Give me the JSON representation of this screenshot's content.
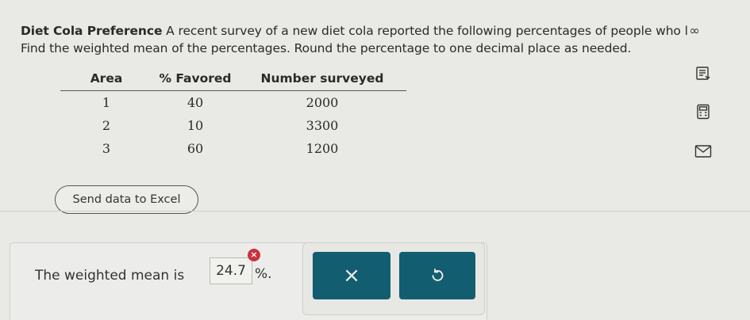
{
  "problem": {
    "title": "Diet Cola Preference",
    "text": " A recent survey of a new diet cola reported the following percentages of people who l",
    "instruction": "Find the weighted mean of the percentages. Round the percentage to one decimal place as needed.",
    "more_icon": "∞"
  },
  "table": {
    "headers": [
      "Area",
      "% Favored",
      "Number surveyed"
    ],
    "rows": [
      [
        "1",
        "40",
        "2000"
      ],
      [
        "2",
        "10",
        "3300"
      ],
      [
        "3",
        "60",
        "1200"
      ]
    ]
  },
  "side_icons": [
    "list-icon",
    "calculator-icon",
    "message-icon"
  ],
  "excel_button": "Send data to Excel",
  "answer": {
    "prefix": "The weighted mean is",
    "value": "24.7",
    "suffix": "%.",
    "error_mark": "×"
  },
  "actions": {
    "clear_label": "×"
  },
  "colors": {
    "accent": "#135d70",
    "error": "#c9323d",
    "background": "#e9e9e6"
  }
}
